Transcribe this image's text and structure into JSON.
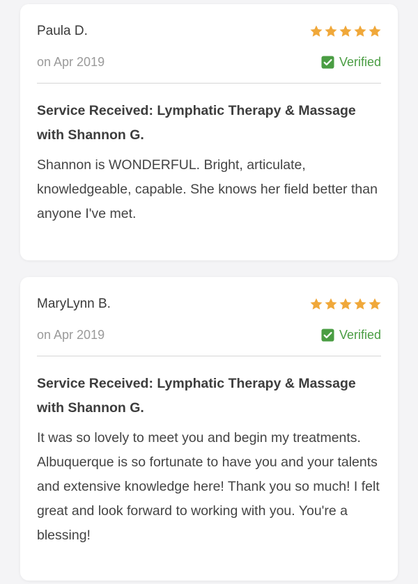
{
  "colors": {
    "star": "#f0a83a",
    "verified": "#4a9d43"
  },
  "reviews": [
    {
      "author": "Paula D.",
      "rating": 5,
      "date": "on Apr 2019",
      "verified_label": "Verified",
      "service": "Service Received: Lymphatic Therapy & Massage with Shannon G.",
      "text": "Shannon is WONDERFUL. Bright, articulate, knowledgeable, capable. She knows her field better than anyone I've met."
    },
    {
      "author": "MaryLynn B.",
      "rating": 5,
      "date": "on Apr 2019",
      "verified_label": "Verified",
      "service": "Service Received: Lymphatic Therapy & Massage with Shannon G.",
      "text": "It was so lovely to meet you and begin my treatments. Albuquerque is so fortunate to have you and your talents and extensive knowledge here! Thank you so much! I felt great and look forward to working with you. You're a blessing!"
    }
  ]
}
